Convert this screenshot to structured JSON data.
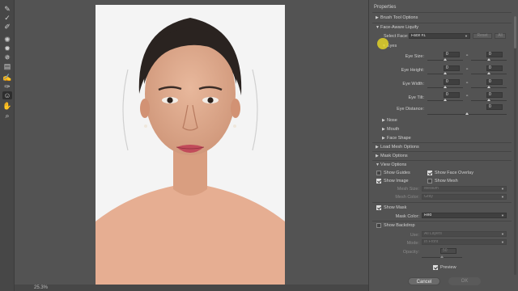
{
  "status": {
    "zoom": "25.3%"
  },
  "panel": {
    "title": "Properties",
    "brush_options": "Brush Tool Options",
    "face_aware": "Face-Aware Liquify",
    "select_face_label": "Select Face:",
    "select_face_value": "Face #1",
    "reset": "Reset",
    "all": "All",
    "eyes": "Eyes",
    "eye_size": "Eye Size:",
    "eye_height": "Eye Height:",
    "eye_width": "Eye Width:",
    "eye_tilt": "Eye Tilt:",
    "eye_distance": "Eye Distance:",
    "eye_values": {
      "size_l": "0",
      "size_r": "0",
      "height_l": "0",
      "height_r": "0",
      "width_l": "0",
      "width_r": "0",
      "tilt_l": "0",
      "tilt_r": "0",
      "distance": "0"
    },
    "nose": "Nose",
    "mouth": "Mouth",
    "face_shape": "Face Shape",
    "load_mesh": "Load Mesh Options",
    "mask_options": "Mask Options",
    "view_options": "View Options",
    "show_guides": "Show Guides",
    "show_face_overlay": "Show Face Overlay",
    "show_image": "Show Image",
    "show_mesh": "Show Mesh",
    "mesh_size_label": "Mesh Size:",
    "mesh_size_value": "Medium",
    "mesh_color_label": "Mesh Color:",
    "mesh_color_value": "Gray",
    "show_mask": "Show Mask",
    "mask_color_label": "Mask Color:",
    "mask_color_value": "Red",
    "show_backdrop": "Show Backdrop",
    "use_label": "Use:",
    "use_value": "All Layers",
    "mode_label": "Mode:",
    "mode_value": "In Front",
    "opacity_label": "Opacity:",
    "opacity_value": "50",
    "preview": "Preview",
    "cancel": "Cancel",
    "ok": "OK"
  },
  "checks": {
    "show_guides": false,
    "show_face_overlay": true,
    "show_image": true,
    "show_mesh": false,
    "show_mask": true,
    "show_backdrop": false,
    "preview": true
  },
  "icons": {
    "tools": [
      "forward-warp-icon",
      "reconstruct-icon",
      "smooth-icon",
      "twirl-icon",
      "pucker-icon",
      "bloat-icon",
      "push-left-icon",
      "freeze-mask-icon",
      "thaw-mask-icon",
      "face-tool-icon",
      "hand-icon",
      "zoom-icon"
    ]
  },
  "colors": {
    "panel_bg": "#535353",
    "accent": "#dcdcdc",
    "highlight": "#e2d228"
  }
}
